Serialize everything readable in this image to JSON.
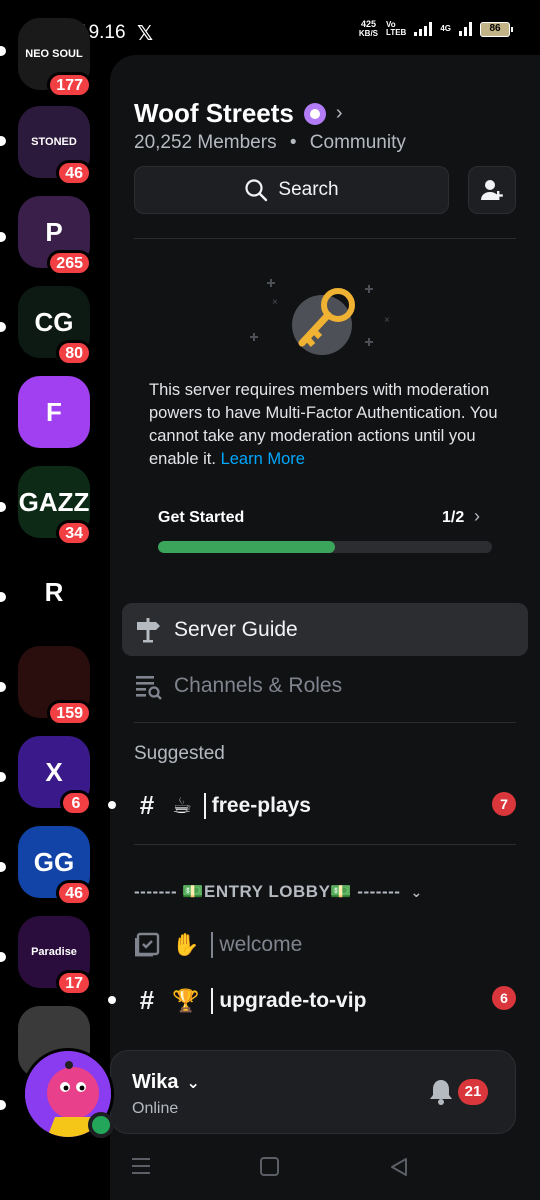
{
  "status_bar": {
    "time": "19.16",
    "x_icon": "𝕏",
    "speed_value": "425",
    "speed_unit": "KB/S",
    "vo_label": "Vo",
    "lte_label": "LTEB",
    "net_label": "4G",
    "battery": "86"
  },
  "servers": [
    {
      "name": "NEO SOUL",
      "badge": "177",
      "bg": "#1a1a1a"
    },
    {
      "name": "STONED",
      "badge": "46",
      "bg": "#2c1a3c"
    },
    {
      "name": "P",
      "badge": "265",
      "bg": "#3a1f4a"
    },
    {
      "name": "CG",
      "badge": "80",
      "bg": "#0d1a14"
    },
    {
      "name": "F",
      "badge": "",
      "bg": "#a040f0"
    },
    {
      "name": "GAZZ",
      "badge": "34",
      "bg": "#0d2a16"
    },
    {
      "name": "R",
      "badge": "",
      "bg": "#000000"
    },
    {
      "name": "dice",
      "badge": "159",
      "bg": "#2a0d0d"
    },
    {
      "name": "X",
      "badge": "6",
      "bg": "#3a1a8a"
    },
    {
      "name": "GG",
      "badge": "46",
      "bg": "#1244a8"
    },
    {
      "name": "Paradise",
      "badge": "17",
      "bg": "#2a0d3c"
    },
    {
      "name": "person",
      "badge": "",
      "bg": "#3a3a3a"
    }
  ],
  "server": {
    "name": "Woof Streets",
    "members": "20,252 Members",
    "dot": "•",
    "type": "Community"
  },
  "search": {
    "label": "Search"
  },
  "mfa": {
    "text": "This server requires members with moderation powers to have Multi-Factor Authentication. You cannot take any moderation actions until you enable it.",
    "link": "Learn More"
  },
  "get_started": {
    "label": "Get Started",
    "count": "1/2",
    "progress": 0.53
  },
  "nav": {
    "server_guide": "Server Guide",
    "channels_roles": "Channels & Roles"
  },
  "suggested": {
    "title": "Suggested",
    "channel": {
      "emoji": "☕",
      "name": "free-plays",
      "unread": "7"
    }
  },
  "category": {
    "name": "------- 💵ENTRY LOBBY💵 -------"
  },
  "channels": [
    {
      "emoji": "✋",
      "name": "welcome"
    },
    {
      "emoji": "🏆",
      "name": "upgrade-to-vip",
      "unread": "6"
    }
  ],
  "user": {
    "name": "Wika",
    "status": "Online",
    "notifications": "21"
  }
}
